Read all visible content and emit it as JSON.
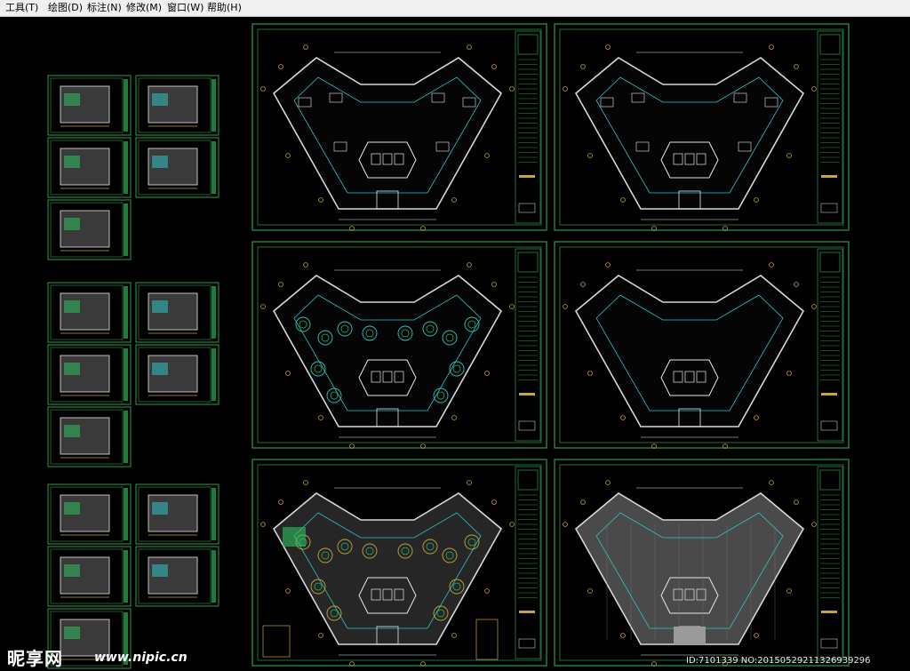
{
  "menu": [
    {
      "label": "工具(T)"
    },
    {
      "label": "绘图(D)"
    },
    {
      "label": "标注(N)"
    },
    {
      "label": "修改(M)"
    },
    {
      "label": "窗口(W)"
    },
    {
      "label": "帮助(H)"
    }
  ],
  "colors": {
    "background": "#000000",
    "frame": "#2e9a4e",
    "plan_line": "#e8e8e8",
    "wall": "#d8d8d8",
    "accent_cyan": "#2fc4c4",
    "accent_yellow": "#c9a43a",
    "accent_green": "#2fbf5f"
  },
  "sheets": {
    "thumbnail_groups": 3,
    "thumbnails_per_group": 5,
    "large_plan_sheets": 6
  },
  "watermark": {
    "logo": "昵享网",
    "url": "www.nipic.cn",
    "id_text": "ID:7101339 NO:20150529211326939296"
  }
}
